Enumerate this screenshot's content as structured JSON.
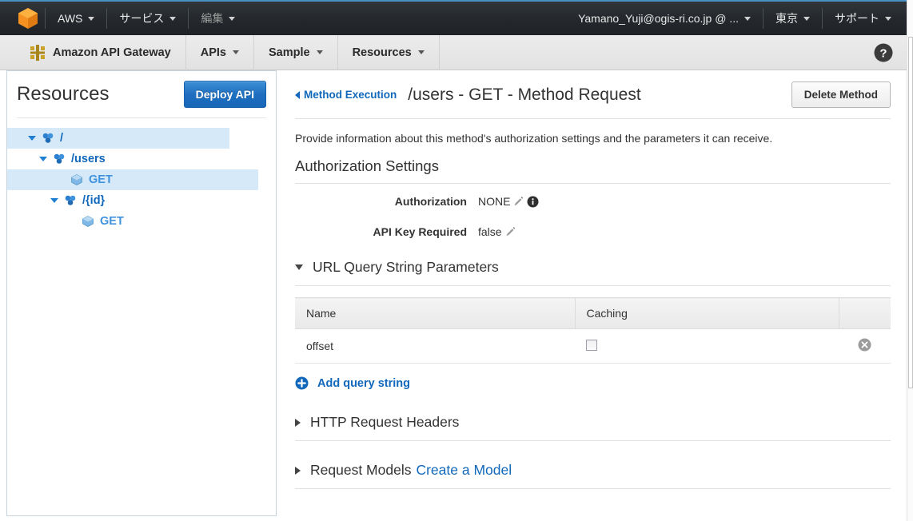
{
  "topbar": {
    "logo_icon": "aws-cube-icon",
    "items": [
      {
        "label": "AWS",
        "caret": true,
        "dim": false
      },
      {
        "label": "サービス",
        "caret": true,
        "dim": false
      },
      {
        "label": "編集",
        "caret": true,
        "dim": true
      }
    ],
    "account": "Yamano_Yuji@ogis-ri.co.jp @ ...",
    "region": "東京",
    "support": "サポート"
  },
  "service_nav": {
    "brand_icon": "api-gateway-icon",
    "brand": "Amazon API Gateway",
    "items": [
      {
        "label": "APIs"
      },
      {
        "label": "Sample"
      },
      {
        "label": "Resources"
      }
    ],
    "help_icon": "help-circle-icon"
  },
  "sidebar": {
    "title": "Resources",
    "deploy_label": "Deploy API",
    "tree": [
      {
        "label": "/",
        "type": "resource",
        "indent": 0,
        "expanded": true,
        "selected": true,
        "icon": "resource-icon"
      },
      {
        "label": "/users",
        "type": "resource",
        "indent": 1,
        "expanded": true,
        "selected": false,
        "icon": "resource-icon"
      },
      {
        "label": "GET",
        "type": "method",
        "indent": 2,
        "expanded": null,
        "selected": true,
        "icon": "method-cube-icon"
      },
      {
        "label": "/{id}",
        "type": "resource",
        "indent": 1,
        "expanded": true,
        "selected": false,
        "icon": "resource-icon"
      },
      {
        "label": "GET",
        "type": "method",
        "indent": 2,
        "expanded": null,
        "selected": false,
        "icon": "method-cube-icon"
      }
    ]
  },
  "main": {
    "back_link": "Method Execution",
    "title": "/users - GET - Method Request",
    "delete_label": "Delete Method",
    "description": "Provide information about this method's authorization settings and the parameters it can receive.",
    "auth_section_title": "Authorization Settings",
    "fields": [
      {
        "label": "Authorization",
        "value": "NONE",
        "has_pencil": true,
        "has_info": true
      },
      {
        "label": "API Key Required",
        "value": "false",
        "has_pencil": true,
        "has_info": false
      }
    ],
    "query_section": {
      "title": "URL Query String Parameters",
      "expanded": true,
      "columns": [
        "Name",
        "Caching",
        ""
      ],
      "rows": [
        {
          "name": "offset",
          "caching": false,
          "remove_icon": "remove-circle-icon"
        }
      ],
      "add_label": "Add query string",
      "add_icon": "plus-circle-icon"
    },
    "collapsed_sections": [
      {
        "title": "HTTP Request Headers",
        "link": ""
      },
      {
        "title": "Request Models",
        "link": "Create a Model"
      }
    ]
  },
  "colors": {
    "accent_blue": "#1168bb",
    "deploy_blue": "#1f6fc0",
    "aws_orange": "#f49020",
    "topbar_dark": "#25292d",
    "selected_row": "#d6e9f8"
  }
}
